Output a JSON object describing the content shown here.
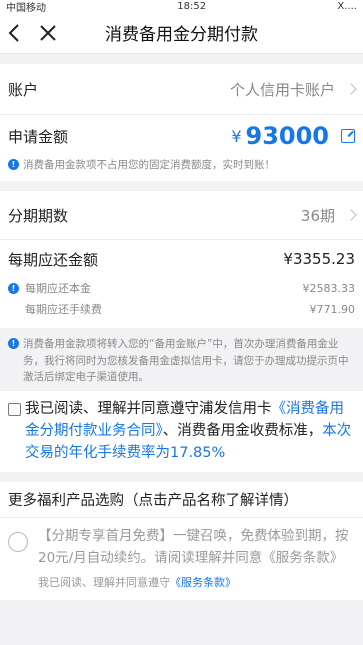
{
  "statusbar": {
    "carrier": "中国移动",
    "time": "18:52",
    "right": "X...."
  },
  "nav": {
    "title": "消费备用金分期付款"
  },
  "account": {
    "label": "账户",
    "value": "个人信用卡账户"
  },
  "amount": {
    "label": "申请金额",
    "currency": "¥",
    "value": "93000",
    "note": "消费备用金款项不占用您的固定消费额度，实时到账！"
  },
  "term": {
    "label": "分期期数",
    "value": "36期"
  },
  "repay": {
    "label": "每期应还金额",
    "value": "¥3355.23",
    "principal_label": "每期应还本金",
    "principal_value": "¥2583.33",
    "fee_label": "每期应还手续费",
    "fee_value": "¥771.90"
  },
  "info_note": "消费备用金款项将转入您的“备用金账户”中，首次办理消费备用金业务，我行将同时为您核发备用金虚拟信用卡，请您于办理成功提示页中激活后绑定电子渠道使用。",
  "agreement": {
    "prefix": "我已阅读、理解并同意遵守浦发信用卡",
    "link": "《消费备用金分期付款业务合同》",
    "middle": "、消费备用金收费标准，",
    "rate": "本次交易的年化手续费率为17.85%"
  },
  "more": {
    "title": "更多福利产品选购（点击产品名称了解详情）"
  },
  "promo": {
    "text": "【分期专享首月免费】一键召唤，免费体验到期，按20元/月自动续约。请阅读理解并同意《服务条款》",
    "sub_prefix": "我已阅读、理解并同意遵守",
    "sub_link": "《服务条款》"
  },
  "colors": {
    "accent": "#1677e6",
    "background": "#f2f2f4"
  }
}
